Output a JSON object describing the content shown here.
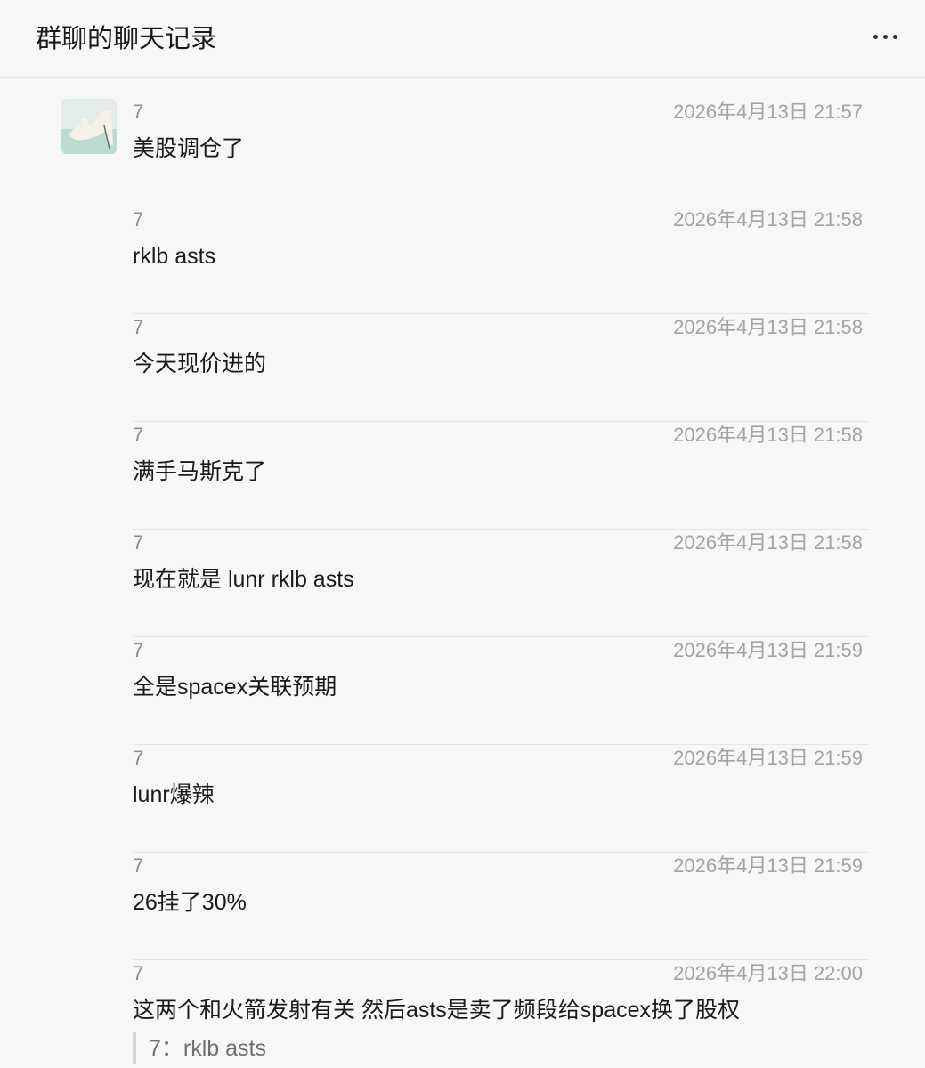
{
  "header": {
    "title": "群聊的聊天记录",
    "more_icon": "more-icon"
  },
  "messages": [
    {
      "sender": "7",
      "time": "2026年4月13日 21:57",
      "text": "美股调仓了"
    },
    {
      "sender": "7",
      "time": "2026年4月13日 21:58",
      "text": "rklb asts"
    },
    {
      "sender": "7",
      "time": "2026年4月13日 21:58",
      "text": "今天现价进的"
    },
    {
      "sender": "7",
      "time": "2026年4月13日 21:58",
      "text": "满手马斯克了"
    },
    {
      "sender": "7",
      "time": "2026年4月13日 21:58",
      "text": "现在就是 lunr rklb asts"
    },
    {
      "sender": "7",
      "time": "2026年4月13日 21:59",
      "text": "全是spacex关联预期"
    },
    {
      "sender": "7",
      "time": "2026年4月13日 21:59",
      "text": "lunr爆辣"
    },
    {
      "sender": "7",
      "time": "2026年4月13日 21:59",
      "text": "26挂了30%"
    },
    {
      "sender": "7",
      "time": "2026年4月13日 22:00",
      "text": "这两个和火箭发射有关 然后asts是卖了频段给spacex换了股权",
      "quote": "7：rklb asts"
    }
  ]
}
